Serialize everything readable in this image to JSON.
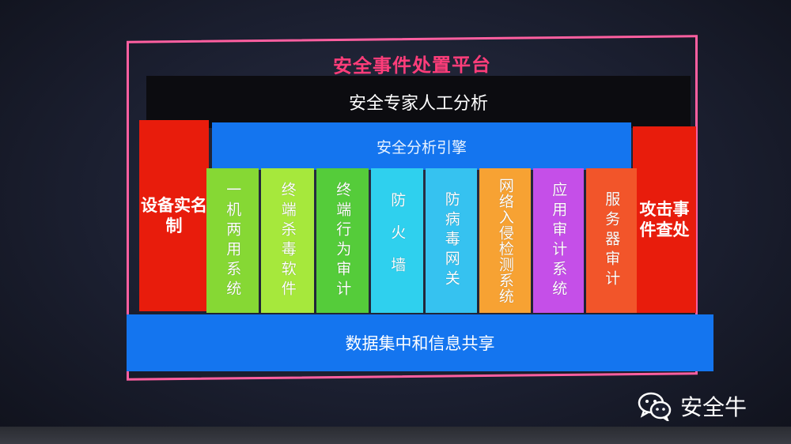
{
  "platform": {
    "title": "安全事件处置平台",
    "expert_layer": "安全专家人工分析",
    "engine_layer": "安全分析引擎",
    "left_pillar": "设备实名制",
    "right_pillar": "攻击事件查处",
    "bottom_layer": "数据集中和信息共享",
    "columns": [
      {
        "label": "一机两用系统",
        "color": "#86d834"
      },
      {
        "label": "终端杀毒软件",
        "color": "#a6e83c"
      },
      {
        "label": "终端行为审计",
        "color": "#55cc3a"
      },
      {
        "label": "防火墙",
        "color": "#2fd0ee"
      },
      {
        "label": "防病毒网关",
        "color": "#36c2f0"
      },
      {
        "label": "网络入侵检测系统",
        "color": "#f7a233"
      },
      {
        "label": "应用审计系统",
        "color": "#c54fe8"
      },
      {
        "label": "服务器审计",
        "color": "#f2552a"
      }
    ]
  },
  "watermark": {
    "text": "安全牛",
    "icon": "wechat-icon"
  },
  "colors": {
    "frame": "#ff5fa0",
    "title": "#ff3d7a",
    "expert_bg": "#0c0c10",
    "engine_bg": "#1475ef",
    "pillar_bg": "#e81c0c",
    "bottom_bg": "#1475ef"
  }
}
